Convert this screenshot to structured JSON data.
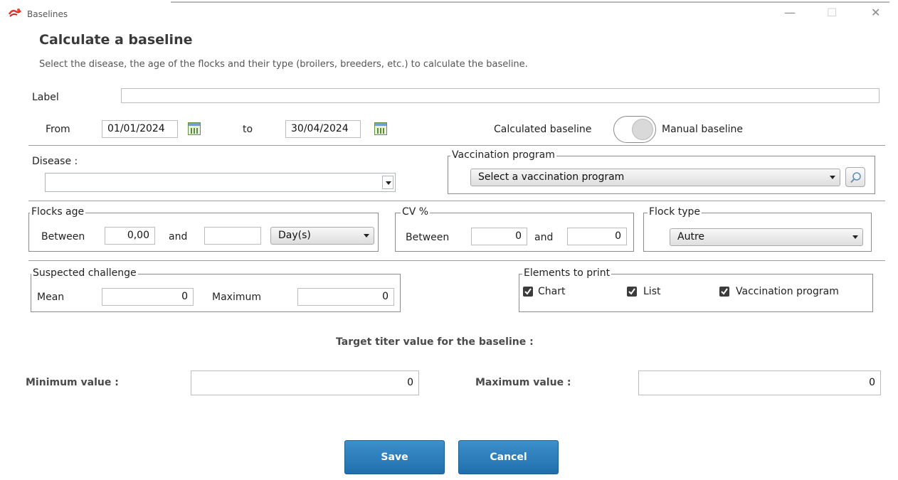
{
  "window": {
    "title": "Baselines",
    "minimize": "—",
    "maximize": "☐",
    "close": "✕"
  },
  "header": {
    "title": "Calculate a baseline",
    "subtitle": "Select the disease, the age of the flocks and their type (broilers, breeders, etc.) to calculate the baseline."
  },
  "form": {
    "label_caption": "Label",
    "label_value": "",
    "from_caption": "From",
    "from_date": "01/01/2024",
    "to_caption": "to",
    "to_date": "30/04/2024",
    "toggle_left": "Calculated baseline",
    "toggle_right": "Manual baseline",
    "disease_caption": "Disease :",
    "disease_value": "",
    "vaccination": {
      "legend": "Vaccination program",
      "value": "Select a vaccination program"
    },
    "flocks_age": {
      "legend": "Flocks age",
      "between": "Between",
      "min": "0,00",
      "and": "and",
      "max": "",
      "unit": "Day(s)"
    },
    "cv": {
      "legend": "CV %",
      "between": "Between",
      "min": "0",
      "and": "and",
      "max": "0"
    },
    "flock_type": {
      "legend": "Flock type",
      "value": "Autre"
    },
    "challenge": {
      "legend": "Suspected challenge",
      "mean_caption": "Mean",
      "mean": "0",
      "max_caption": "Maximum",
      "max": "0"
    },
    "print": {
      "legend": "Elements to print",
      "chart": "Chart",
      "list": "List",
      "vaccination": "Vaccination program"
    },
    "target": {
      "title": "Target titer value for the baseline :",
      "min_caption": "Minimum value :",
      "min": "0",
      "max_caption": "Maximum value :",
      "max": "0"
    }
  },
  "buttons": {
    "save": "Save",
    "cancel": "Cancel"
  },
  "colors": {
    "button": "#2b7dbb",
    "checkbox": "#3c3c3c"
  }
}
